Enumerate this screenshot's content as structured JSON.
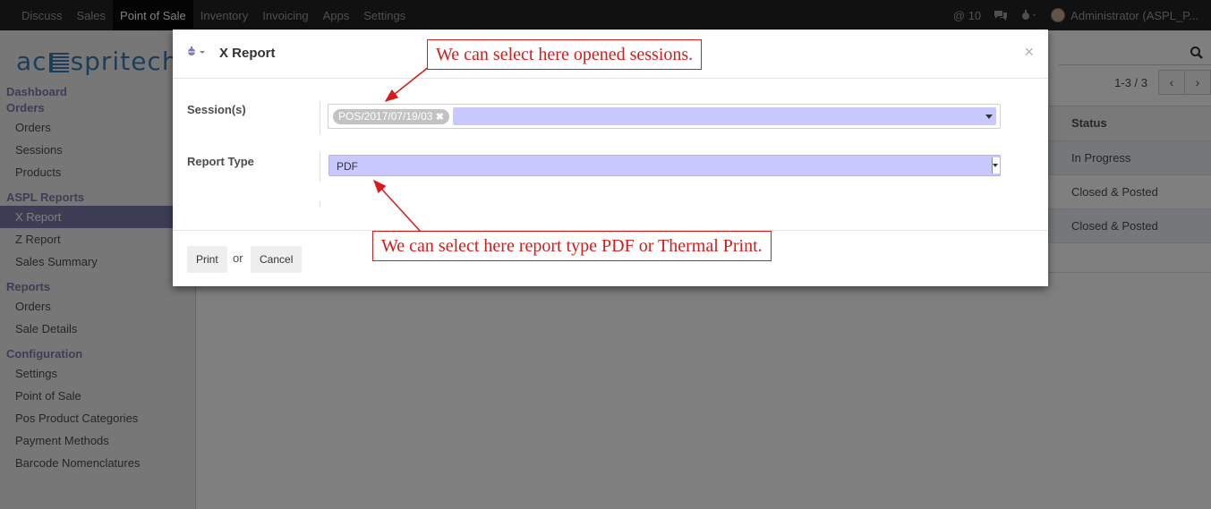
{
  "topbar": {
    "menu": [
      "Discuss",
      "Sales",
      "Point of Sale",
      "Inventory",
      "Invoicing",
      "Apps",
      "Settings"
    ],
    "active_index": 2,
    "at_count": "@ 10",
    "user": "Administrator (ASPL_P..."
  },
  "sidebar": {
    "logo_left": "ac",
    "logo_right": "spritech",
    "sections": [
      {
        "header": "Dashboard"
      },
      {
        "header": "Orders",
        "items": [
          "Orders",
          "Sessions",
          "Products"
        ]
      },
      {
        "header": "ASPL Reports",
        "items": [
          "X Report",
          "Z Report",
          "Sales Summary"
        ]
      },
      {
        "header": "Reports",
        "items": [
          "Orders",
          "Sale Details"
        ]
      },
      {
        "header": "Configuration",
        "items": [
          "Settings",
          "Point of Sale",
          "Pos Product Categories",
          "Payment Methods",
          "Barcode Nomenclatures"
        ]
      }
    ],
    "active_item": "X Report"
  },
  "main": {
    "pager": "1-3 / 3",
    "column_status": "Status",
    "rows": [
      "In Progress",
      "Closed & Posted",
      "Closed & Posted"
    ]
  },
  "dialog": {
    "title": "X Report",
    "close": "×",
    "session_label": "Session(s)",
    "session_tag": "POS/2017/07/19/03",
    "report_type_label": "Report Type",
    "report_type_value": "PDF",
    "print": "Print",
    "or": "or",
    "cancel": "Cancel"
  },
  "annotations": {
    "top": "We can select here opened sessions.",
    "bottom": "We can select here report type PDF or Thermal Print.",
    "color": "#d91a1a"
  },
  "icons": [
    "at-icon",
    "chat-icon",
    "bug-icon",
    "search-icon",
    "chevron-left-icon",
    "chevron-right-icon",
    "close-icon"
  ]
}
